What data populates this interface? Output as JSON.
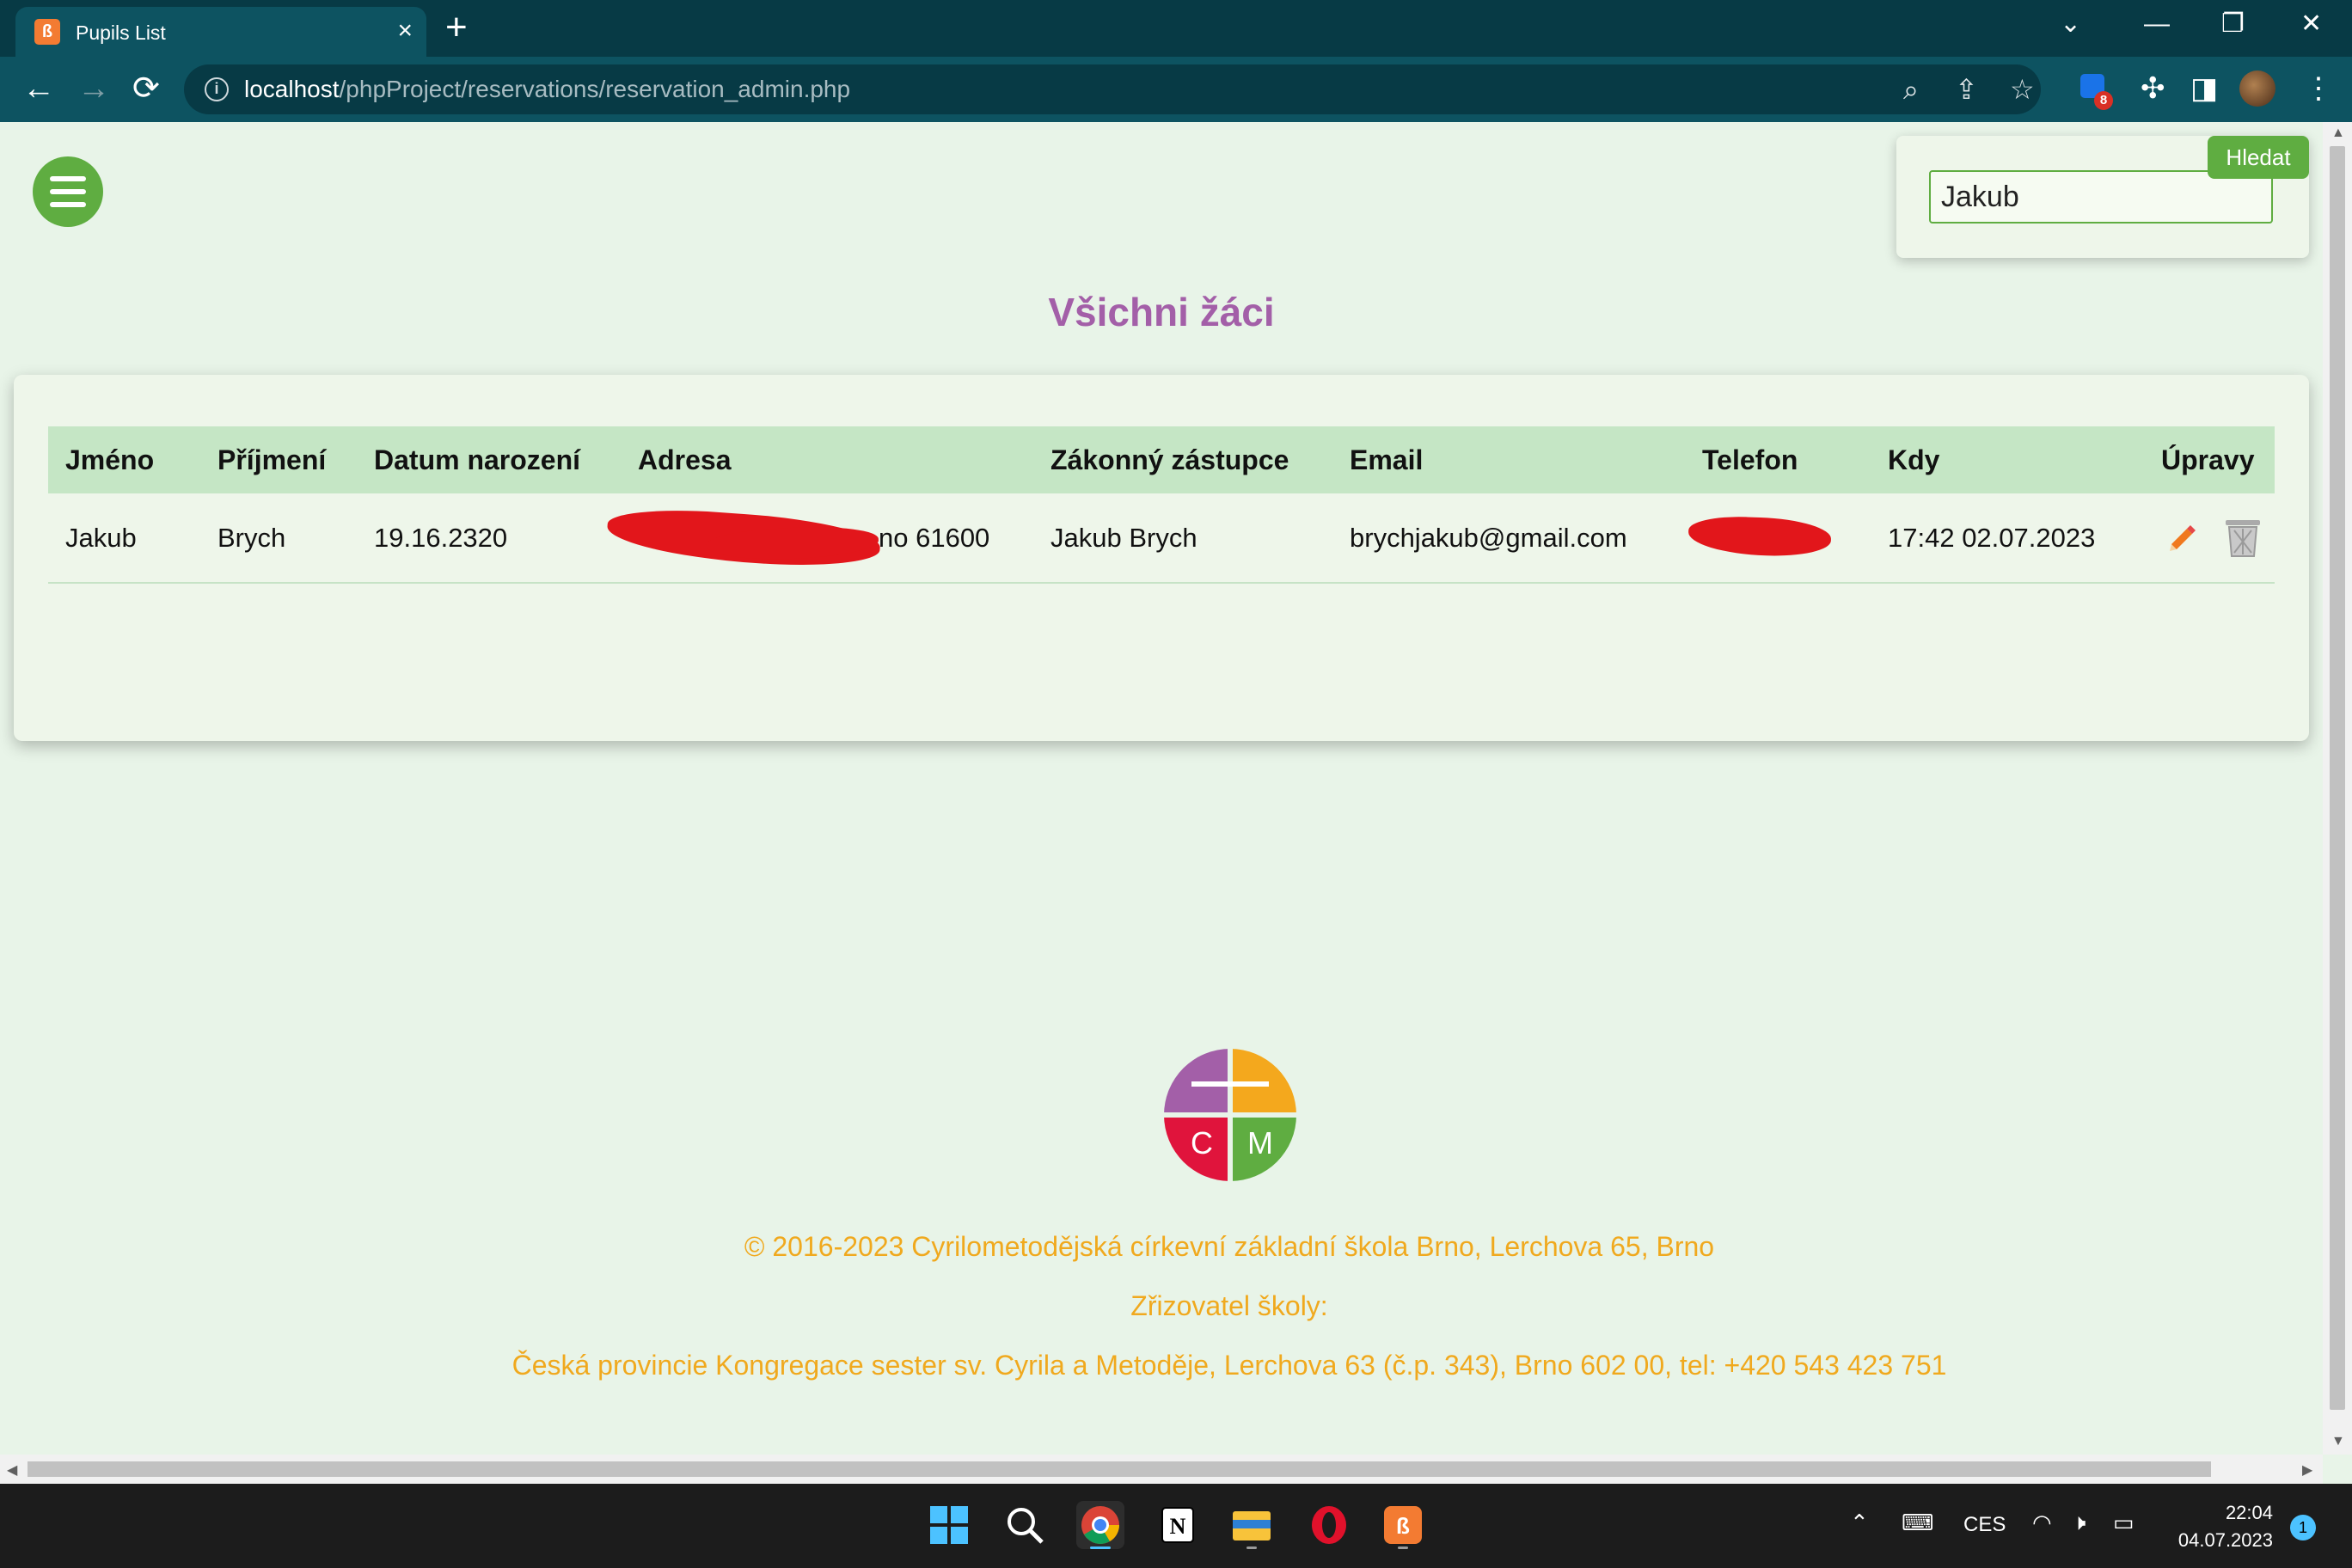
{
  "browser": {
    "tab_title": "Pupils List",
    "tab_close": "×",
    "new_tab": "+",
    "url_host": "localhost",
    "url_path": "/phpProject/reservations/reservation_admin.php",
    "extension_badge": "8",
    "window_controls": {
      "dropdown": "⌄",
      "minimize": "—",
      "restore": "❐",
      "close": "✕"
    }
  },
  "search": {
    "value": "Jakub",
    "button_label": "Hledat"
  },
  "page": {
    "title": "Všichni žáci"
  },
  "table": {
    "headers": [
      "Jméno",
      "Příjmení",
      "Datum narození",
      "Adresa",
      "Zákonný zástupce",
      "Email",
      "Telefon",
      "Kdy",
      "Úpravy"
    ],
    "rows": [
      {
        "jmeno": "Jakub",
        "prijmeni": "Brych",
        "datum_narozeni": "19.16.2320",
        "adresa_visible": "no 61600",
        "zakonny_zastupce": "Jakub Brych",
        "email": "brychjakub@gmail.com",
        "kdy": "17:42 02.07.2023"
      }
    ]
  },
  "footer": {
    "logo_letters": [
      "C",
      "M"
    ],
    "copyright": "© 2016-2023 Cyrilometodějská církevní základní škola Brno, Lerchova 65, Brno",
    "founder_label": "Zřizovatel školy:",
    "founder_text": "Česká provincie Kongregace sester sv. Cyrila a Metoděje, Lerchova 63 (č.p. 343), Brno 602 00, tel: +420 543 423 751"
  },
  "taskbar": {
    "language": "CES",
    "time": "22:04",
    "date": "04.07.2023",
    "notifications": "1"
  },
  "colors": {
    "accent_green": "#5fad41",
    "title_purple": "#a35fa8",
    "footer_orange": "#f0a91e",
    "chrome_dark": "#073a45",
    "chrome_mid": "#0d5361"
  }
}
